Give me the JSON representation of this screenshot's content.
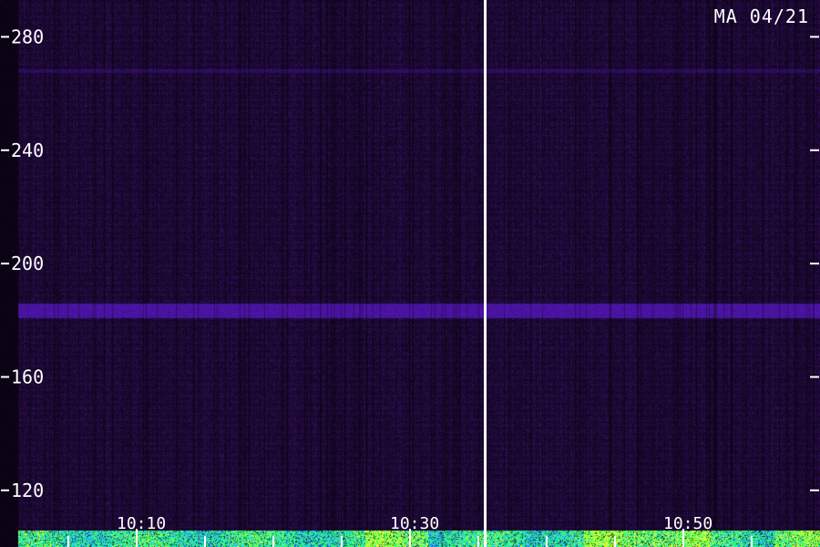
{
  "corner_label": "MA 04/21",
  "colors": {
    "background": "#1a0830",
    "band_mid": "#3f108f",
    "band_strong": "#5a18c8",
    "low_blue": "#2a50ff",
    "low_cyan": "#20d0e0",
    "low_green": "#40ff60",
    "low_yellow": "#e8ff30",
    "marker": "#ffffff",
    "text": "#ffffff"
  },
  "chart_data": {
    "type": "heatmap",
    "title": "",
    "xlabel": "",
    "ylabel": "",
    "yticks": [
      120,
      160,
      200,
      240,
      280
    ],
    "ylim": [
      100,
      293
    ],
    "xtick_labels": [
      "10:10",
      "10:30",
      "10:50"
    ],
    "xlim_minutes": [
      0,
      60
    ],
    "xtick_positions_minutes": [
      10,
      30,
      50
    ],
    "minor_xticks_minutes": [
      5,
      10,
      15,
      20,
      25,
      30,
      35,
      40,
      45,
      50,
      55
    ],
    "time_marker_minutes": 35.5,
    "horizontal_bands": [
      {
        "y": 183.5,
        "strength": "strong"
      },
      {
        "y": 268,
        "strength": "weak"
      }
    ],
    "low_frequency_activity": {
      "y_from": 100,
      "y_to": 106,
      "level": "high"
    }
  }
}
